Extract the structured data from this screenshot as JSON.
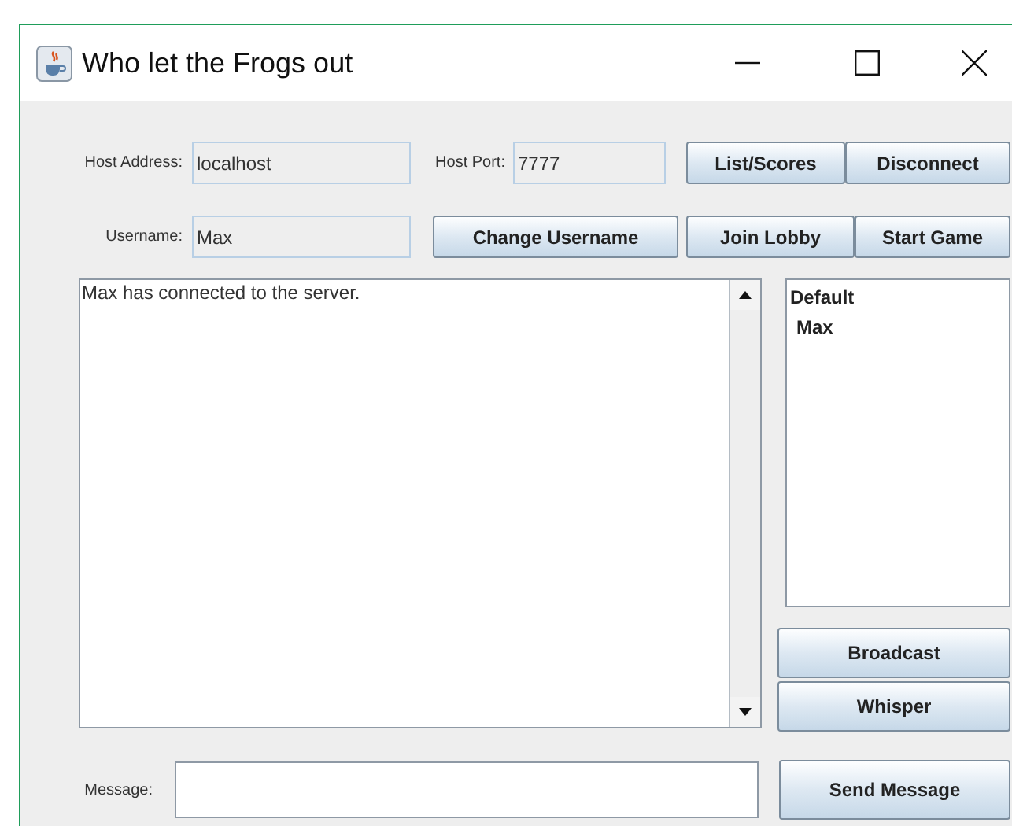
{
  "window": {
    "title": "Who let the Frogs out"
  },
  "connection": {
    "host_address": {
      "label": "Host Address:",
      "value": "localhost"
    },
    "host_port": {
      "label": "Host Port:",
      "value": "7777"
    },
    "username": {
      "label": "Username:",
      "value": "Max"
    }
  },
  "change_username_button": "Change Username",
  "game_buttons": [
    [
      "List/Scores",
      "Disconnect"
    ],
    [
      "Join Lobby",
      "Start Game"
    ]
  ],
  "chat": {
    "messages": [
      "Max has connected to the server."
    ]
  },
  "lobby_list": {
    "items": [
      {
        "label": "Default",
        "children": [
          {
            "label": "Max"
          }
        ]
      }
    ]
  },
  "send_mode_buttons": [
    "Broadcast",
    "Whisper"
  ],
  "message": {
    "label": "Message:"
  },
  "send_button": "Send Message"
}
